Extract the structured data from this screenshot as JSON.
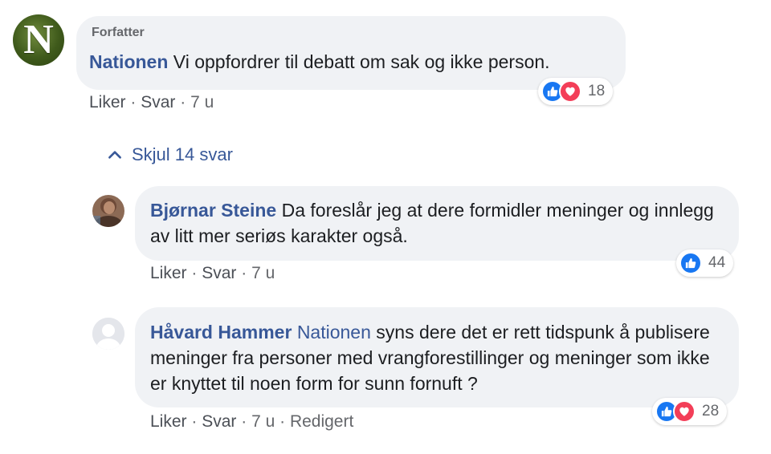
{
  "comment": {
    "badge": "Forfatter",
    "avatar_letter": "N",
    "author": "Nationen",
    "text": "Vi oppfordrer til debatt om sak og ikke person.",
    "actions": {
      "like": "Liker",
      "reply": "Svar",
      "time": "7 u"
    },
    "reactions": {
      "count": "18",
      "types": [
        "like-icon",
        "love-icon"
      ]
    }
  },
  "replies_toggle": {
    "label": "Skjul 14 svar",
    "icon": "chevron-up-icon"
  },
  "replies": [
    {
      "author": "Bjørnar Steine",
      "text": "Da foreslår jeg at dere formidler meninger og innlegg av litt mer seriøs karakter også.",
      "actions": {
        "like": "Liker",
        "reply": "Svar",
        "time": "7 u"
      },
      "reactions": {
        "count": "44",
        "types": [
          "like-icon"
        ]
      }
    },
    {
      "author": "Håvard Hammer",
      "mention": "Nationen",
      "text": "syns dere det er rett tidspunk å publisere meninger fra personer med vrangforestillinger og meninger som ikke er knyttet til noen form for sunn fornuft ?",
      "actions": {
        "like": "Liker",
        "reply": "Svar",
        "time": "7 u",
        "edited": "Redigert"
      },
      "reactions": {
        "count": "28",
        "types": [
          "like-icon",
          "love-icon"
        ]
      }
    }
  ],
  "colors": {
    "bubble": "#f0f2f5",
    "name": "#385898",
    "meta": "#65676b",
    "like": "#1877f2",
    "love": "#f33e58"
  }
}
